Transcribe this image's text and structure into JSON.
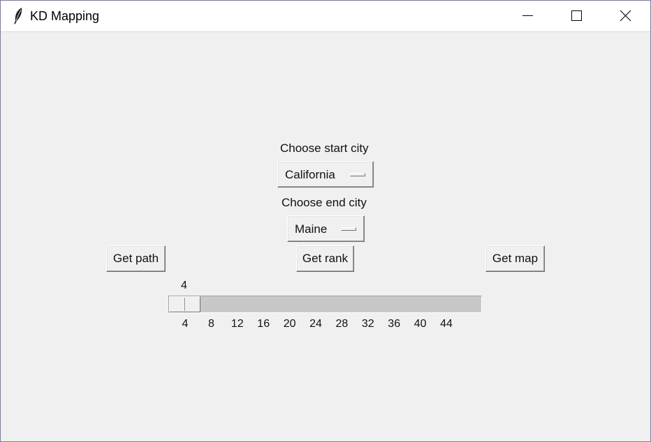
{
  "window": {
    "title": "KD Mapping",
    "controls": {
      "minimize": "minimize-icon",
      "maximize": "maximize-icon",
      "close": "close-icon"
    }
  },
  "form": {
    "start_label": "Choose start city",
    "start_value": "California",
    "end_label": "Choose end city",
    "end_value": "Maine"
  },
  "buttons": {
    "get_path": "Get path",
    "get_rank": "Get rank",
    "get_map": "Get map"
  },
  "slider": {
    "value": "4",
    "min": 4,
    "max": 47,
    "ticks": [
      "4",
      "8",
      "12",
      "16",
      "20",
      "24",
      "28",
      "32",
      "36",
      "40",
      "44"
    ]
  },
  "colors": {
    "background": "#f0f0f0",
    "titlebar": "#ffffff",
    "trough": "#c8c8c8"
  }
}
